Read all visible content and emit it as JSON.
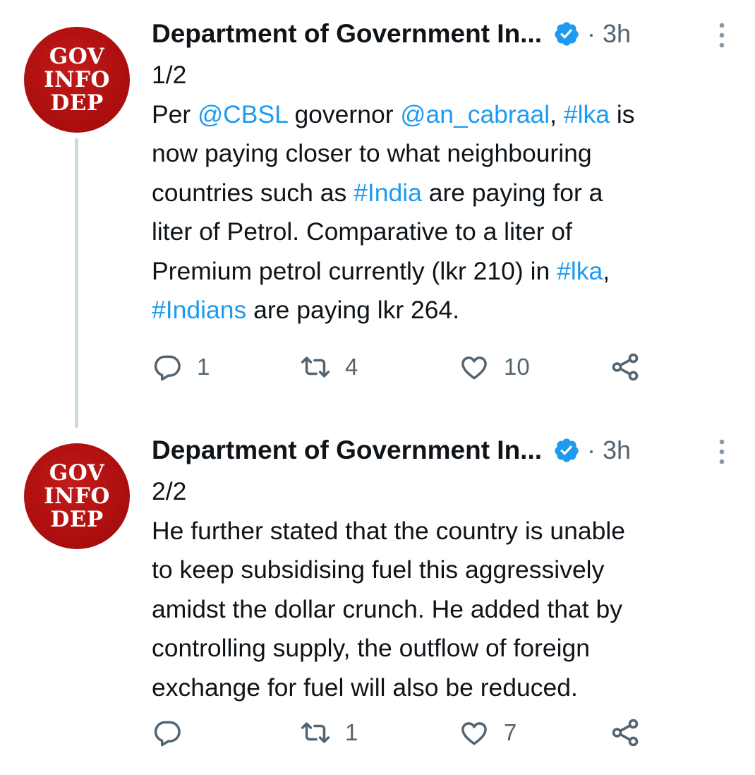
{
  "tweets": [
    {
      "avatar": {
        "lines": [
          "GOV",
          "INFO",
          "DEP"
        ]
      },
      "author": "Department of Government In...",
      "time": "· 3h",
      "thread_label": "1/2",
      "text_lines": [
        [
          {
            "t": "Per ",
            "link": false
          },
          {
            "t": "@CBSL",
            "link": true
          },
          {
            "t": " governor ",
            "link": false
          },
          {
            "t": "@an_cabraal",
            "link": true
          },
          {
            "t": ", ",
            "link": false
          },
          {
            "t": "#lka",
            "link": true
          },
          {
            "t": " is",
            "link": false
          }
        ],
        [
          {
            "t": "now paying closer to what neighbouring",
            "link": false
          }
        ],
        [
          {
            "t": "countries such as ",
            "link": false
          },
          {
            "t": "#India",
            "link": true
          },
          {
            "t": " are paying for a",
            "link": false
          }
        ],
        [
          {
            "t": "liter of Petrol. Comparative to a liter of",
            "link": false
          }
        ],
        [
          {
            "t": "Premium petrol currently (lkr 210) in ",
            "link": false
          },
          {
            "t": "#lka",
            "link": true
          },
          {
            "t": ",",
            "link": false
          }
        ],
        [
          {
            "t": "#Indians",
            "link": true
          },
          {
            "t": " are paying lkr 264.",
            "link": false
          }
        ]
      ],
      "actions": {
        "replies": "1",
        "retweets": "4",
        "likes": "10"
      }
    },
    {
      "avatar": {
        "lines": [
          "GOV",
          "INFO",
          "DEP"
        ]
      },
      "author": "Department of Government In...",
      "time": "· 3h",
      "thread_label": "2/2",
      "text_lines": [
        [
          {
            "t": "He further stated that the country is unable",
            "link": false
          }
        ],
        [
          {
            "t": "to keep subsidising fuel this aggressively",
            "link": false
          }
        ],
        [
          {
            "t": "amidst the dollar crunch. He added that by",
            "link": false
          }
        ],
        [
          {
            "t": "controlling supply, the outflow of foreign",
            "link": false
          }
        ],
        [
          {
            "t": "exchange for fuel will also be reduced.",
            "link": false
          }
        ]
      ],
      "actions": {
        "replies": "",
        "retweets": "1",
        "likes": "7"
      }
    }
  ],
  "colors": {
    "link": "#1d9bf0",
    "verified": "#1d9bf0",
    "secondary_text": "#536471",
    "avatar_bg": "#ad0f0f",
    "thread_line": "#cfd9de"
  },
  "icons": {
    "reply": "reply-icon",
    "retweet": "retweet-icon",
    "like": "like-icon",
    "share": "share-icon",
    "verified": "verified-badge-icon",
    "more": "more-options-icon"
  }
}
